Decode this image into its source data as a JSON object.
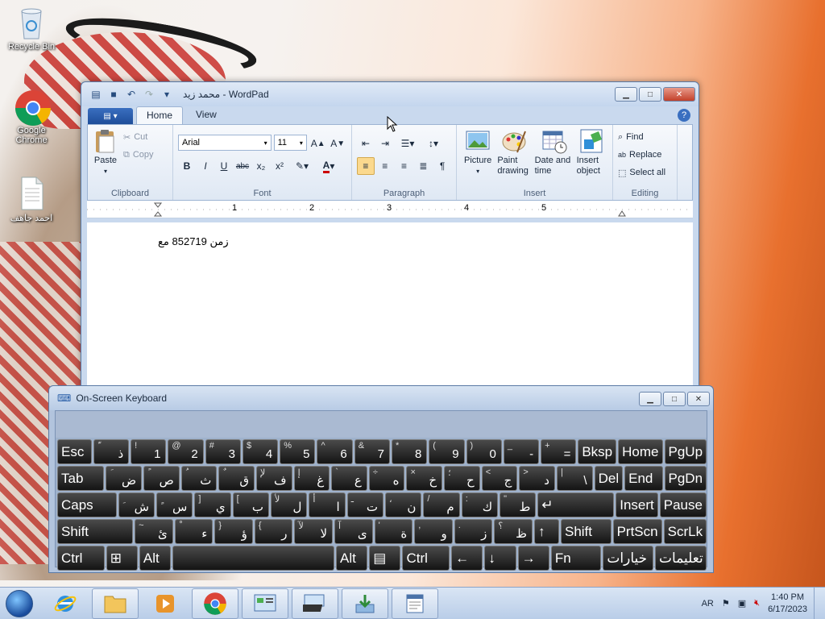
{
  "desktop": {
    "icons": [
      {
        "label": "Recycle Bin"
      },
      {
        "label": "Google Chrome"
      },
      {
        "label": "احمد جاهف"
      }
    ]
  },
  "wordpad": {
    "title": "محمد زيد - WordPad",
    "tabs": [
      "Home",
      "View"
    ],
    "clipboard": {
      "paste": "Paste",
      "cut": "Cut",
      "copy": "Copy",
      "label": "Clipboard"
    },
    "font": {
      "family": "Arial",
      "size": "11",
      "label": "Font"
    },
    "paragraph": {
      "label": "Paragraph"
    },
    "insert": {
      "picture": "Picture",
      "paint_drawing": "Paint drawing",
      "date_time": "Date and time",
      "insert_object": "Insert object",
      "label": "Insert"
    },
    "editing": {
      "find": "Find",
      "replace": "Replace",
      "select_all": "Select all",
      "label": "Editing"
    },
    "ruler_marks": [
      "1",
      "2",
      "3",
      "4",
      "5"
    ],
    "document_text": "زمن 852719 مع"
  },
  "osk": {
    "title": "On-Screen Keyboard",
    "rows": [
      [
        {
          "m": "Esc"
        },
        {
          "s": "ّ",
          "m": "ذ"
        },
        {
          "s": "!",
          "m": "1"
        },
        {
          "s": "@",
          "m": "2"
        },
        {
          "s": "#",
          "m": "3"
        },
        {
          "s": "$",
          "m": "4"
        },
        {
          "s": "%",
          "m": "5"
        },
        {
          "s": "^",
          "m": "6"
        },
        {
          "s": "&",
          "m": "7"
        },
        {
          "s": "*",
          "m": "8"
        },
        {
          "s": "(",
          "m": "9"
        },
        {
          "s": ")",
          "m": "0"
        },
        {
          "s": "_",
          "m": "-"
        },
        {
          "s": "+",
          "m": "="
        },
        {
          "m": "Bksp"
        },
        {
          "m": "Home"
        },
        {
          "m": "PgUp"
        }
      ],
      [
        {
          "m": "Tab"
        },
        {
          "s": "َ",
          "m": "ض"
        },
        {
          "s": "ً",
          "m": "ص"
        },
        {
          "s": "ُ",
          "m": "ث"
        },
        {
          "s": "ٌ",
          "m": "ق"
        },
        {
          "s": "لإ",
          "m": "ف"
        },
        {
          "s": "إ",
          "m": "غ"
        },
        {
          "s": "`",
          "m": "ع"
        },
        {
          "s": "÷",
          "m": "ه"
        },
        {
          "s": "×",
          "m": "خ"
        },
        {
          "s": "؛",
          "m": "ح"
        },
        {
          "s": "<",
          "m": "ج"
        },
        {
          "s": ">",
          "m": "د"
        },
        {
          "s": "|",
          "m": "\\"
        },
        {
          "m": "Del"
        },
        {
          "m": "End"
        },
        {
          "m": "PgDn"
        }
      ],
      [
        {
          "m": "Caps"
        },
        {
          "s": "ِ",
          "m": "ش"
        },
        {
          "s": "ٍ",
          "m": "س"
        },
        {
          "s": "]",
          "m": "ي"
        },
        {
          "s": "[",
          "m": "ب"
        },
        {
          "s": "لأ",
          "m": "ل"
        },
        {
          "s": "أ",
          "m": "ا"
        },
        {
          "s": "ـ",
          "m": "ت"
        },
        {
          "s": "،",
          "m": "ن"
        },
        {
          "s": "/",
          "m": "م"
        },
        {
          "s": ":",
          "m": "ك"
        },
        {
          "s": "\"",
          "m": "ط"
        },
        {
          "m": "↵"
        },
        {
          "m": "Insert"
        },
        {
          "m": "Pause"
        }
      ],
      [
        {
          "m": "Shift"
        },
        {
          "s": "~",
          "m": "ئ"
        },
        {
          "s": "ْ",
          "m": "ء"
        },
        {
          "s": "}",
          "m": "ؤ"
        },
        {
          "s": "{",
          "m": "ر"
        },
        {
          "s": "لآ",
          "m": "لا"
        },
        {
          "s": "آ",
          "m": "ى"
        },
        {
          "s": "'",
          "m": "ة"
        },
        {
          "s": ",",
          "m": "و"
        },
        {
          "s": ".",
          "m": "ز"
        },
        {
          "s": "؟",
          "m": "ظ"
        },
        {
          "m": "↑"
        },
        {
          "m": "Shift"
        },
        {
          "m": "PrtScn"
        },
        {
          "m": "ScrLk"
        }
      ],
      [
        {
          "m": "Ctrl"
        },
        {
          "m": "⊞"
        },
        {
          "m": "Alt"
        },
        {
          "m": ""
        },
        {
          "m": "Alt"
        },
        {
          "m": "▤"
        },
        {
          "m": "Ctrl"
        },
        {
          "m": "←"
        },
        {
          "m": "↓"
        },
        {
          "m": "→"
        },
        {
          "m": "Fn"
        },
        {
          "m": "خيارات"
        },
        {
          "m": "تعليمات"
        }
      ]
    ]
  },
  "taskbar": {
    "language": "AR",
    "time": "1:40 PM",
    "date": "6/17/2023"
  }
}
